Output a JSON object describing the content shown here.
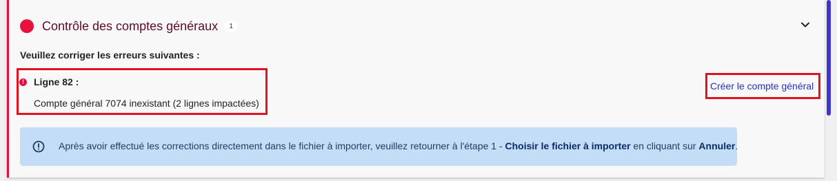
{
  "section": {
    "title": "Contrôle des comptes généraux",
    "badge_count": "1",
    "status_color": "#e8123c"
  },
  "intro_text": "Veuillez corriger les erreurs suivantes :",
  "error": {
    "line_label": "Ligne 82 :",
    "message": "Compte général 7074 inexistant (2 lignes impactées)",
    "icon_glyph": "!"
  },
  "action": {
    "create_label": "Créer le compte général"
  },
  "info": {
    "text_before": "Après avoir effectué les corrections directement dans le fichier à importer, veuillez retourner à l'étape 1 - ",
    "bold_step": "Choisir le fichier à importer",
    "text_middle": " en cliquant sur ",
    "bold_cancel": "Annuler",
    "text_end": "."
  },
  "icons": {
    "status": "status-dot-icon",
    "expand": "chevron-down-icon",
    "error": "error-icon",
    "info": "info-icon"
  }
}
